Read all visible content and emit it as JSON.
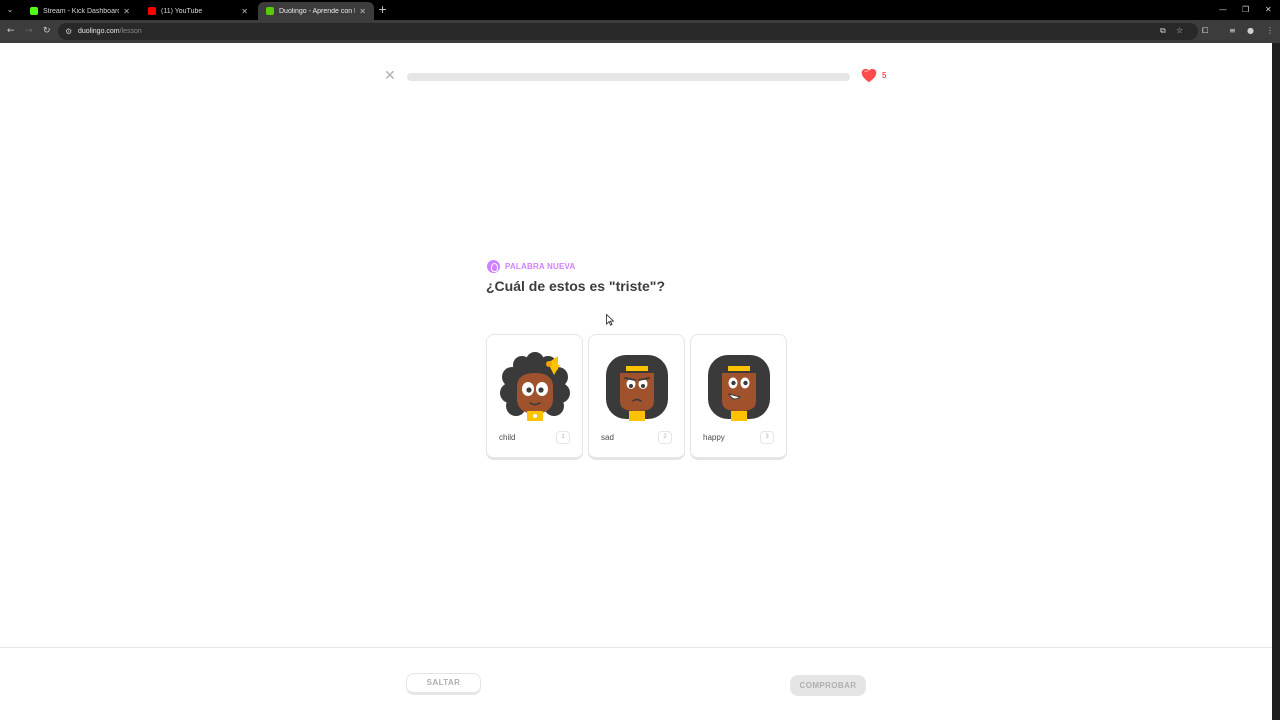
{
  "browser": {
    "tabs": [
      {
        "title": "Stream - Kick Dashboard",
        "favicon_color": "#53fc18",
        "active": false
      },
      {
        "title": "(11) YouTube",
        "favicon_color": "#ff0000",
        "active": false
      },
      {
        "title": "Duolingo - Aprende con leccio",
        "favicon_color": "#58cc02",
        "active": true
      }
    ],
    "url_host": "duolingo.com",
    "url_path": "/lesson"
  },
  "lesson": {
    "progress_fraction": 0.0,
    "hearts": "5",
    "badge_label": "PALABRA NUEVA",
    "question": "¿Cuál de estos es \"triste\"?",
    "choices": [
      {
        "label": "child",
        "key": "1",
        "image": "child-character-icon"
      },
      {
        "label": "sad",
        "key": "2",
        "image": "sad-character-icon"
      },
      {
        "label": "happy",
        "key": "3",
        "image": "happy-character-icon"
      }
    ]
  },
  "footer": {
    "skip_label": "SALTAR",
    "check_label": "COMPROBAR"
  },
  "colors": {
    "heart": "#ff4b4b",
    "badge": "#ce82ff",
    "skin": "#a0522d",
    "hair": "#3a3a3a",
    "accent_yellow": "#ffc200",
    "disabled_gray": "#afafaf",
    "border": "#e5e5e5"
  }
}
